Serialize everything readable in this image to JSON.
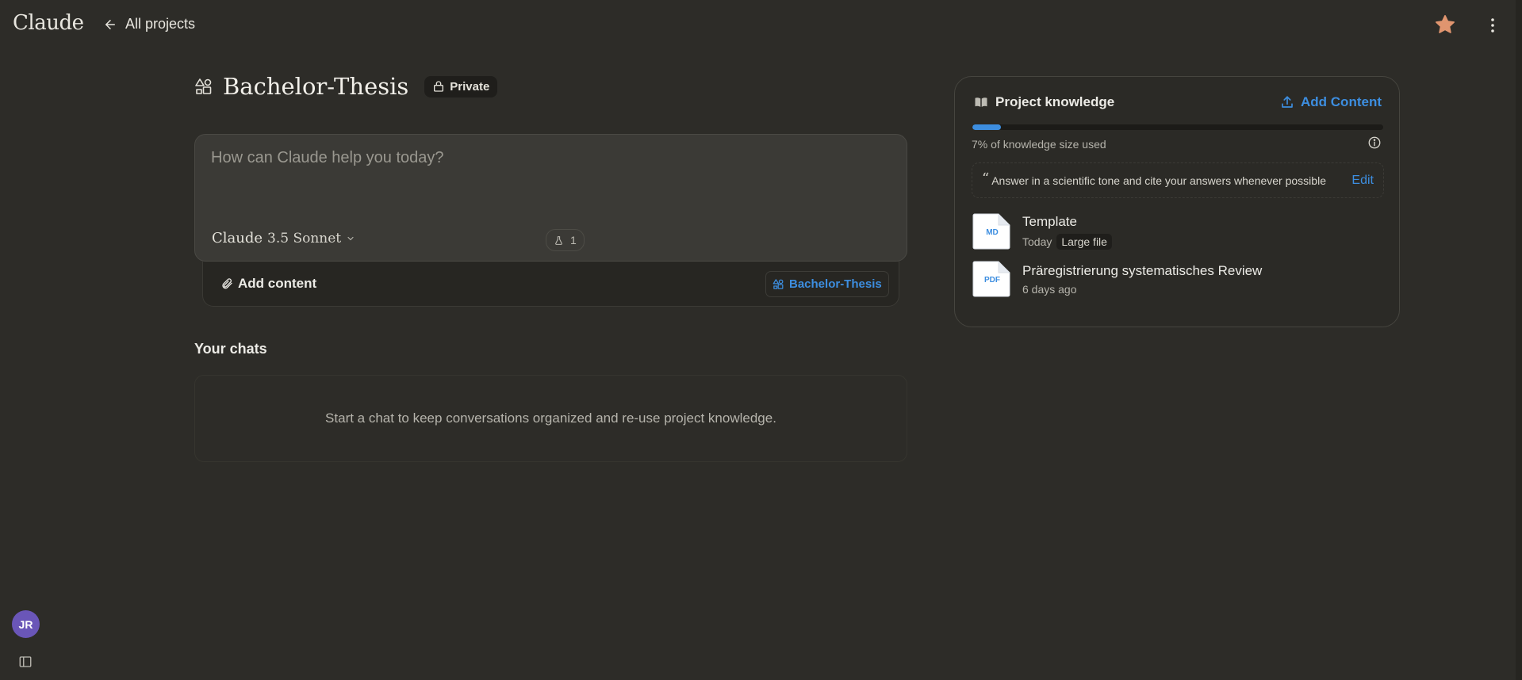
{
  "app": {
    "logo": "Claude",
    "back_label": "All projects"
  },
  "project": {
    "title": "Bachelor-Thesis",
    "visibility": "Private"
  },
  "composer": {
    "placeholder": "How can Claude help you today?",
    "model_brand": "Claude",
    "model_version": "3.5 Sonnet",
    "style_count": "1",
    "add_content_label": "Add content",
    "project_chip_label": "Bachelor-Thesis"
  },
  "chats": {
    "heading": "Your chats",
    "empty_text": "Start a chat to keep conversations organized and re-use project knowledge."
  },
  "knowledge": {
    "title": "Project knowledge",
    "add_label": "Add Content",
    "usage_percent": 7,
    "usage_text": "7% of knowledge size used",
    "instructions_quote": "“",
    "instructions": "Answer in a scientific tone and cite your answers whenever possible",
    "edit_label": "Edit",
    "files": [
      {
        "type": "MD",
        "name": "Template",
        "date": "Today",
        "tag": "Large file"
      },
      {
        "type": "PDF",
        "name": "Präregistrierung systematisches Review",
        "date": "6 days ago",
        "tag": ""
      }
    ]
  },
  "user": {
    "initials": "JR"
  },
  "colors": {
    "accent": "#3d8ee0",
    "star": "#e0956f",
    "avatar": "#6a56b8",
    "background": "#2d2c28"
  },
  "icons": [
    "arrow-left-icon",
    "star-icon",
    "more-vertical-icon",
    "project-icon",
    "lock-icon",
    "chevron-down-icon",
    "flask-icon",
    "paperclip-icon",
    "book-icon",
    "upload-icon",
    "info-icon",
    "file-icon",
    "sidebar-toggle-icon"
  ]
}
